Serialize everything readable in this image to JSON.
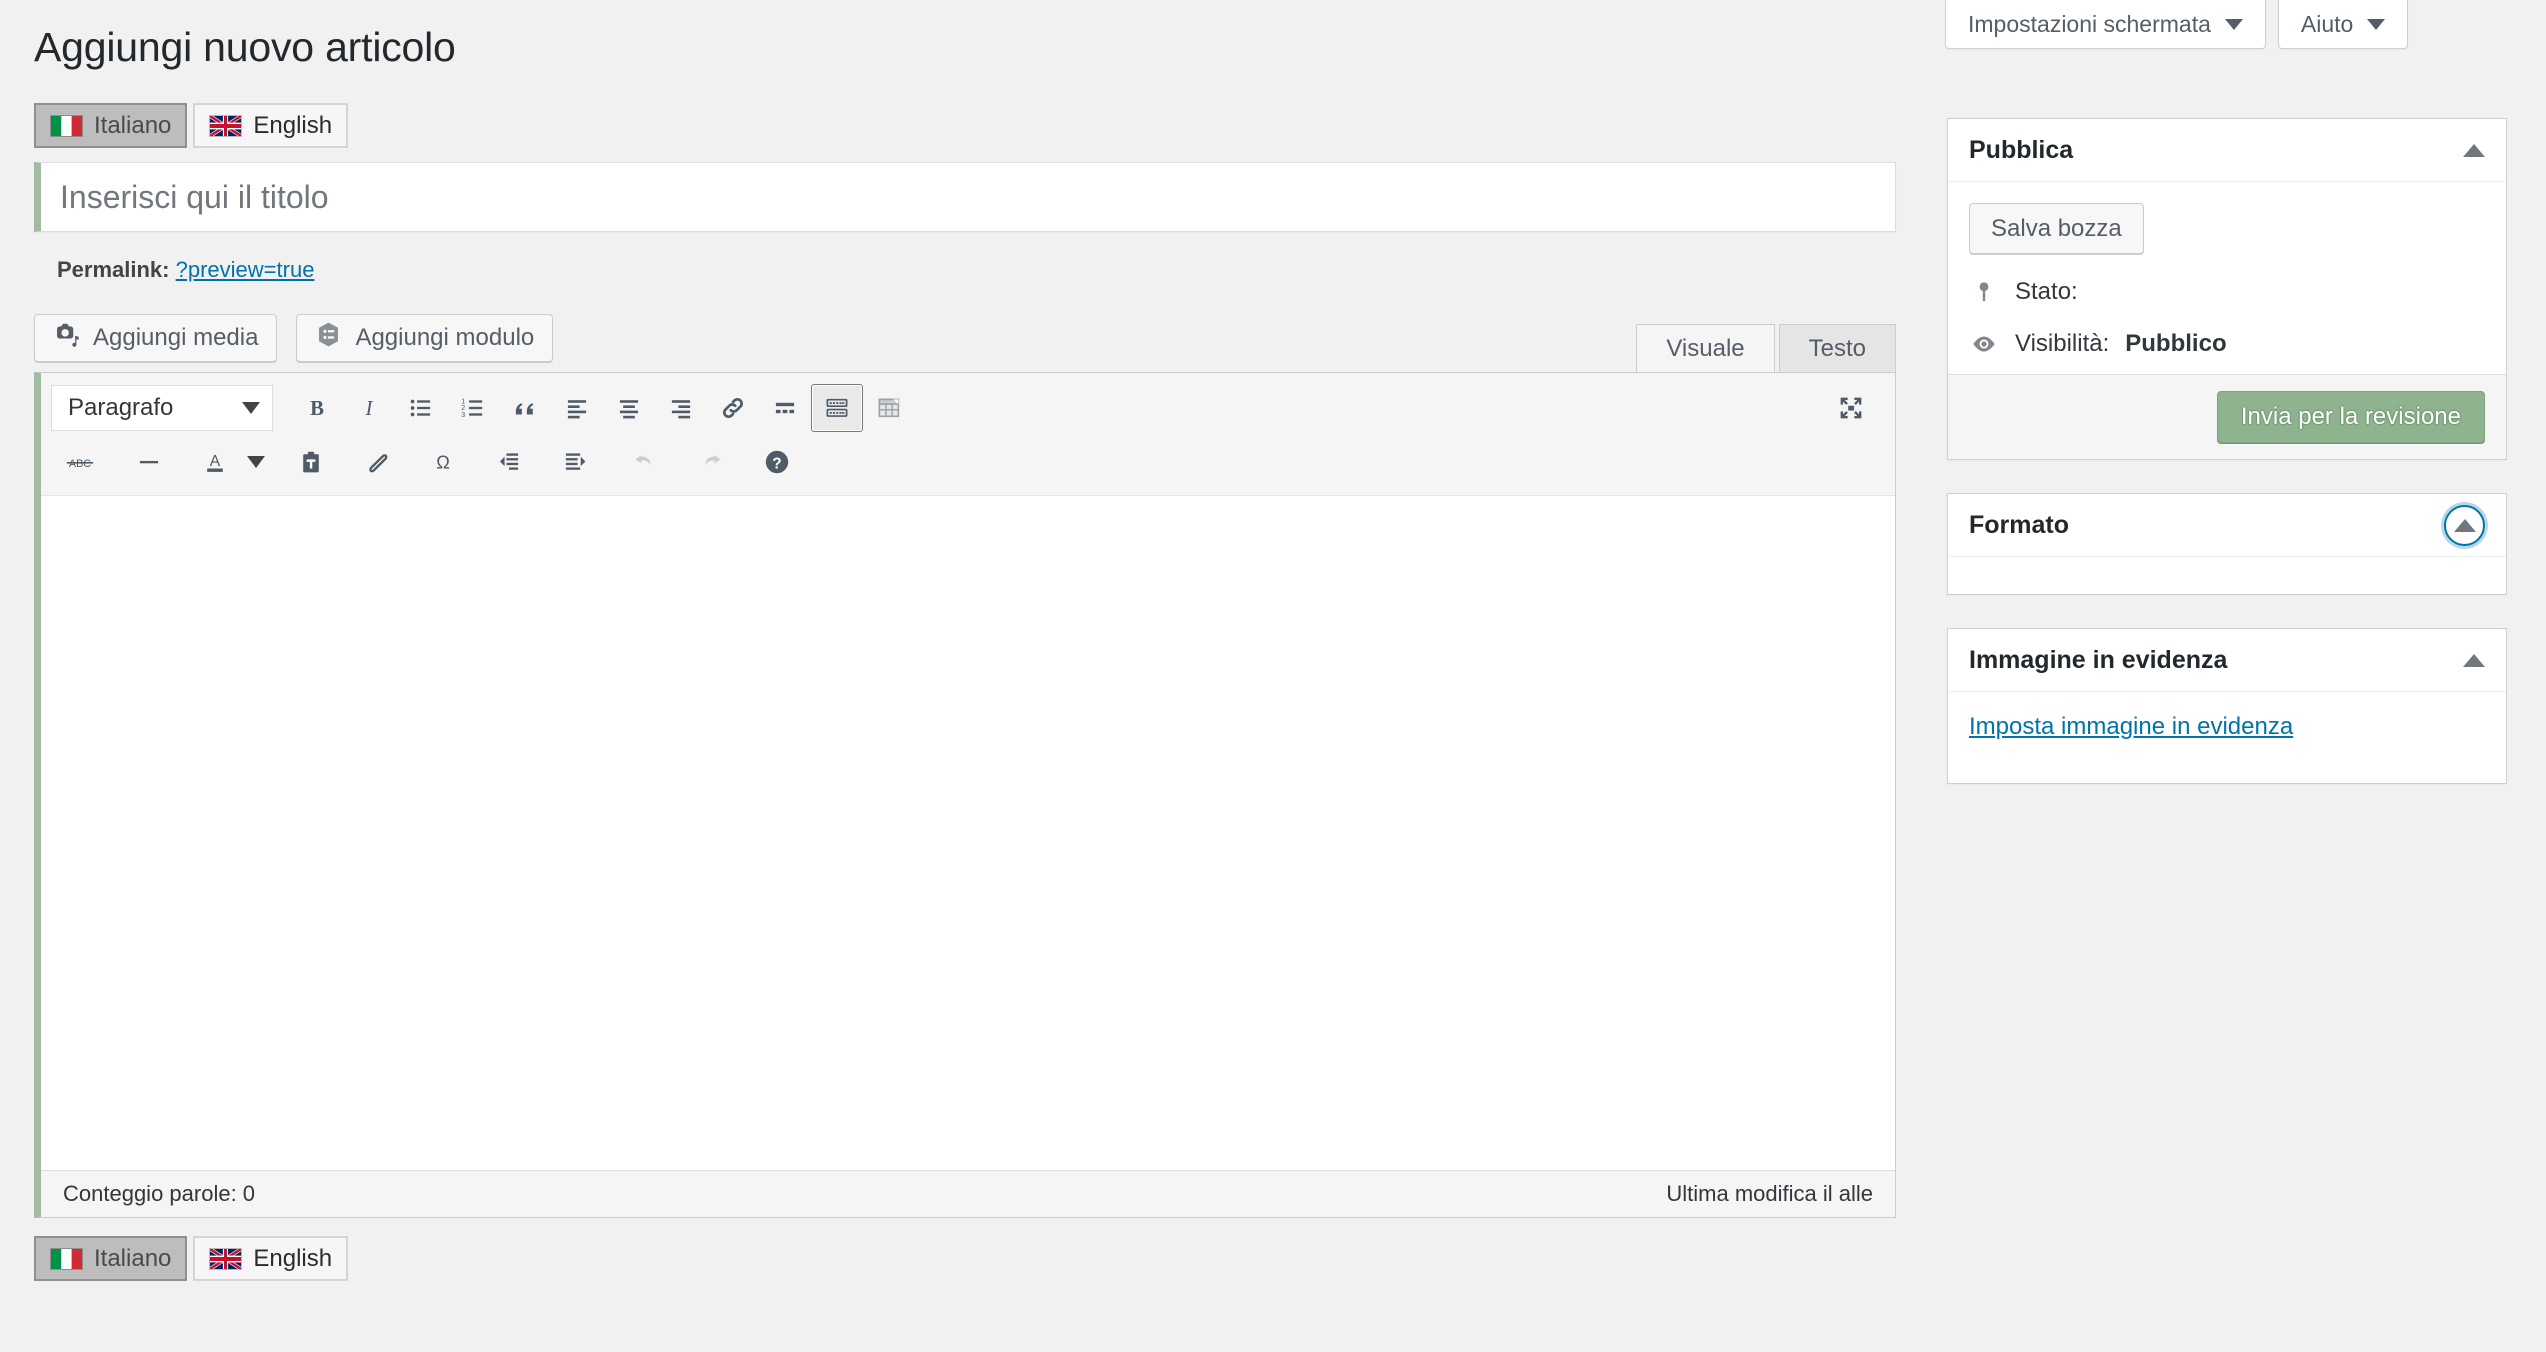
{
  "header": {
    "screen_options_label": "Impostazioni schermata",
    "help_label": "Aiuto"
  },
  "page_title": "Aggiungi nuovo articolo",
  "language_tabs": [
    {
      "label": "Italiano",
      "flag": "it",
      "active": true
    },
    {
      "label": "English",
      "flag": "gb",
      "active": false
    }
  ],
  "title_field": {
    "value": "",
    "placeholder": "Inserisci qui il titolo"
  },
  "permalink": {
    "label": "Permalink:",
    "url_text": "?preview=true"
  },
  "media_buttons": [
    {
      "label": "Aggiungi media",
      "icon": "add-media-icon"
    },
    {
      "label": "Aggiungi modulo",
      "icon": "add-form-icon"
    }
  ],
  "editor_tabs": [
    {
      "label": "Visuale",
      "active": true
    },
    {
      "label": "Testo",
      "active": false
    }
  ],
  "toolbar": {
    "format_select": "Paragrafo",
    "row1": [
      {
        "name": "bold-icon",
        "title": "Grassetto"
      },
      {
        "name": "italic-icon",
        "title": "Corsivo"
      },
      {
        "name": "bullet-list-icon",
        "title": "Elenco puntato"
      },
      {
        "name": "numbered-list-icon",
        "title": "Elenco numerato"
      },
      {
        "name": "blockquote-icon",
        "title": "Citazione"
      },
      {
        "name": "align-left-icon",
        "title": "Allinea a sinistra"
      },
      {
        "name": "align-center-icon",
        "title": "Allinea al centro"
      },
      {
        "name": "align-right-icon",
        "title": "Allinea a destra"
      },
      {
        "name": "link-icon",
        "title": "Inserisci link"
      },
      {
        "name": "read-more-icon",
        "title": "Inserisci tag Altro"
      },
      {
        "name": "toolbar-toggle-icon",
        "title": "Altri strumenti"
      },
      {
        "name": "table-icon",
        "title": "Tabella"
      }
    ],
    "row2": [
      {
        "name": "strikethrough-icon",
        "title": "Barrato"
      },
      {
        "name": "horizontal-rule-icon",
        "title": "Linea orizzontale"
      },
      {
        "name": "text-color-icon",
        "title": "Colore testo"
      },
      {
        "name": "text-color-caret-icon",
        "title": "Scegli colore"
      },
      {
        "name": "paste-as-text-icon",
        "title": "Incolla come testo"
      },
      {
        "name": "clear-formatting-icon",
        "title": "Rimuovi formattazione"
      },
      {
        "name": "special-character-icon",
        "title": "Carattere speciale"
      },
      {
        "name": "outdent-icon",
        "title": "Riduci rientro"
      },
      {
        "name": "indent-icon",
        "title": "Aumenta rientro"
      },
      {
        "name": "undo-icon",
        "title": "Annulla"
      },
      {
        "name": "redo-icon",
        "title": "Ripeti"
      },
      {
        "name": "keyboard-help-icon",
        "title": "Scorciatoie da tastiera"
      }
    ],
    "fullscreen": {
      "name": "fullscreen-icon",
      "title": "Scrittura senza distrazioni"
    }
  },
  "editor_content": "",
  "statusbar": {
    "word_count": "Conteggio parole: 0",
    "last_edited": "Ultima modifica il alle"
  },
  "sidebar": {
    "publish": {
      "title": "Pubblica",
      "save_draft_label": "Salva bozza",
      "status_label": "Stato:",
      "visibility_label": "Visibilità:",
      "visibility_value": "Pubblico",
      "submit_label": "Invia per la revisione"
    },
    "format": {
      "title": "Formato"
    },
    "featured_image": {
      "title": "Immagine in evidenza",
      "set_link": "Imposta immagine in evidenza"
    }
  },
  "colors": {
    "accent_green": "#8fb28f",
    "link_blue": "#0073aa",
    "title_border": "#a2bba2",
    "focus_ring": "#0073aa",
    "page_bg": "#f1f1f1"
  }
}
